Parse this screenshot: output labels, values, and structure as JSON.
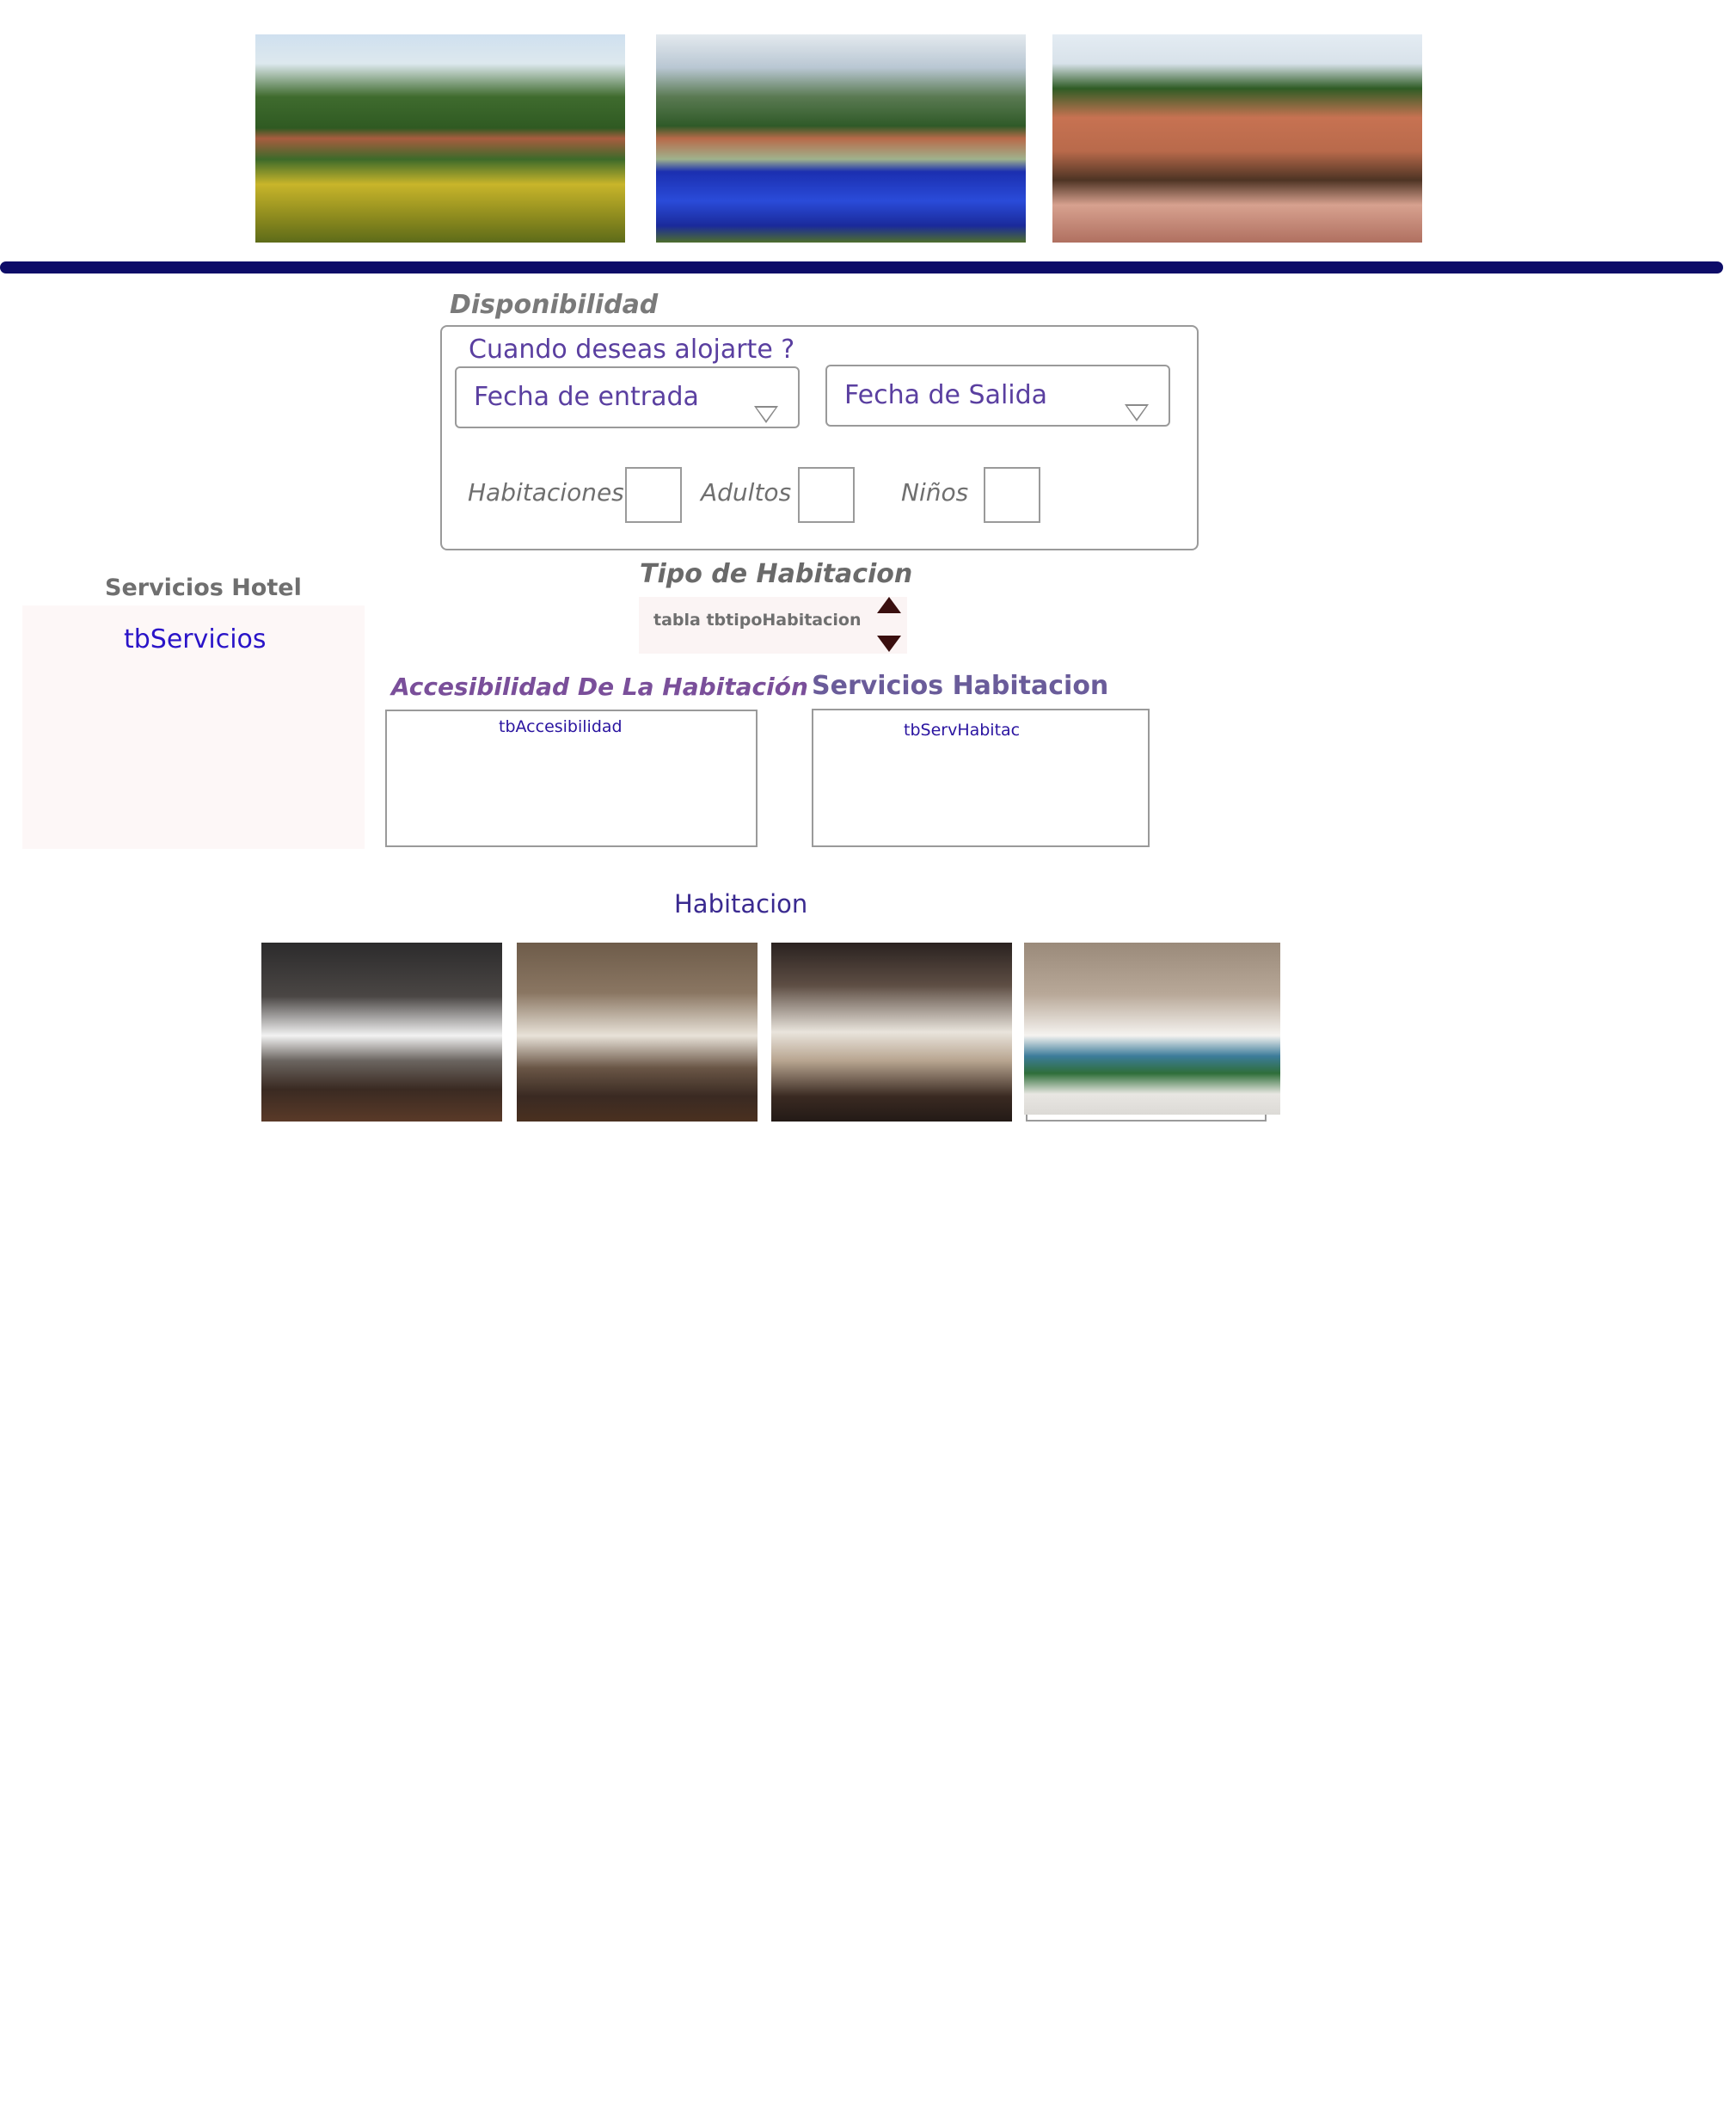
{
  "gallery": {
    "images": [
      "garden-cabins-photo",
      "pool-photo",
      "brick-cabin-photo"
    ]
  },
  "availability": {
    "section_title": "Disponibilidad",
    "question": "Cuando deseas alojarte ?",
    "checkin_label": "Fecha de entrada",
    "checkout_label": "Fecha de Salida",
    "rooms_label": "Habitaciones",
    "adults_label": "Adultos",
    "children_label": "Niños"
  },
  "hotel_services": {
    "title": "Servicios Hotel",
    "table_label": "tbServicios"
  },
  "room_type": {
    "title": "Tipo de Habitacion",
    "table_label": "tabla tbtipoHabitacion"
  },
  "accessibility": {
    "title": "Accesibilidad De La Habitación",
    "table_label": "tbAccesibilidad"
  },
  "room_services": {
    "title": "Servicios Habitacion",
    "table_label": "tbServHabitac"
  },
  "rooms_gallery": {
    "title": "Habitacion",
    "images": [
      "room-photo-1",
      "room-photo-2",
      "room-photo-3",
      "room-photo-4"
    ]
  },
  "colors": {
    "header_bar": "#0d0c68",
    "accent_purple": "#5a3fa0",
    "link_blue": "#2a14c8",
    "title_gray": "#7a7a7a",
    "panel_bg": "#fdf7f7"
  }
}
